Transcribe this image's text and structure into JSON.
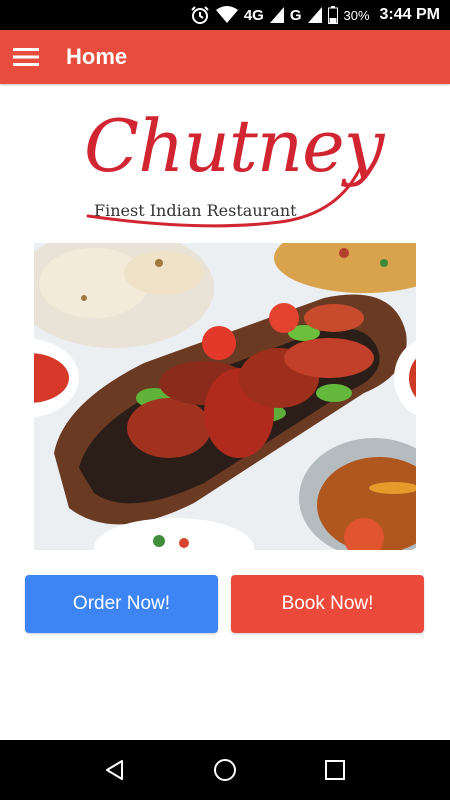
{
  "status_bar": {
    "network_4g": "4G",
    "network_g": "G",
    "battery": "30%",
    "time": "3:44 PM"
  },
  "app_bar": {
    "title": "Home",
    "color": "#e74c3c"
  },
  "logo": {
    "name": "Chutney",
    "tagline": "Finest Indian Restaurant"
  },
  "actions": {
    "order_label": "Order Now!",
    "book_label": "Book Now!",
    "order_color": "#3d84f4",
    "book_color": "#eb4a3b"
  },
  "icons": {
    "menu": "hamburger-icon",
    "alarm": "alarm-icon",
    "wifi": "wifi-icon",
    "back": "back-triangle-icon",
    "home": "home-circle-icon",
    "recents": "recents-square-icon"
  }
}
